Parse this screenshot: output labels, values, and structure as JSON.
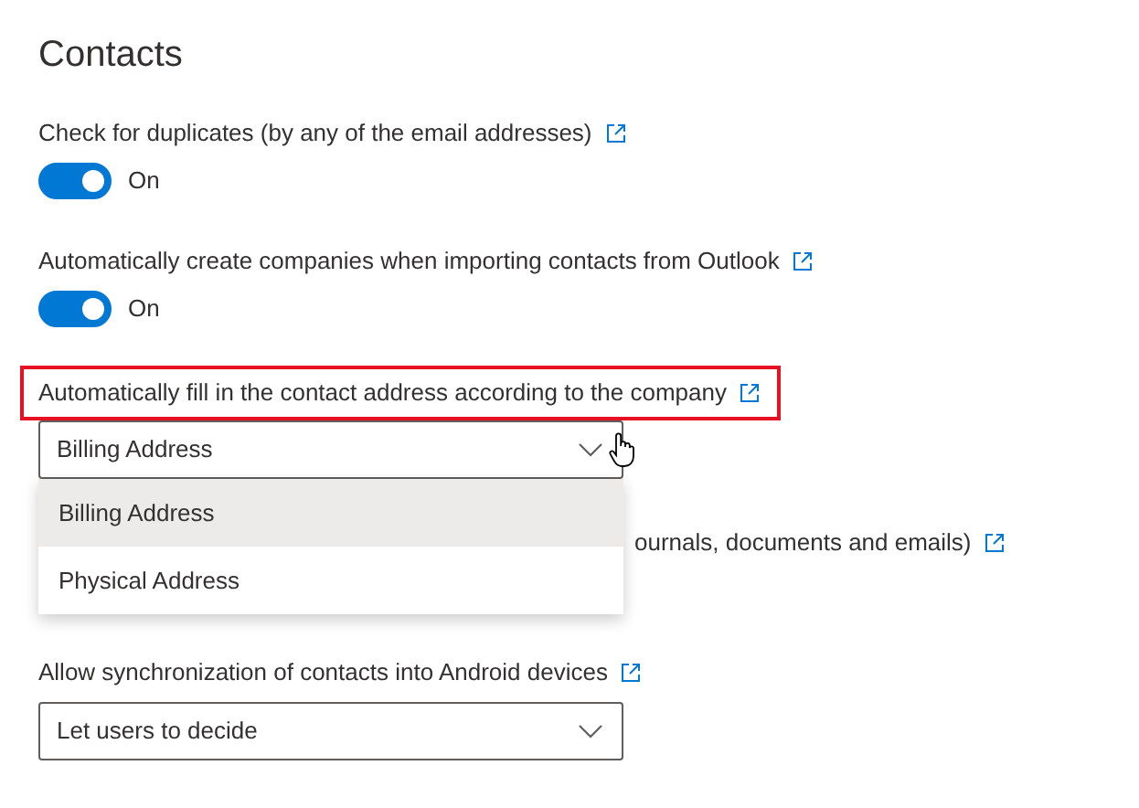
{
  "title": "Contacts",
  "settings": [
    {
      "kind": "toggle",
      "label": "Check for duplicates (by any of the email addresses)",
      "on": true,
      "state_text": "On"
    },
    {
      "kind": "toggle",
      "label": "Automatically create companies when importing contacts from Outlook",
      "on": true,
      "state_text": "On"
    },
    {
      "kind": "dropdown",
      "label": "Automatically fill in the contact address according to the company",
      "highlighted": true,
      "value": "Billing Address",
      "expanded": true,
      "options": [
        {
          "label": "Billing Address",
          "selected": true
        },
        {
          "label": "Physical Address",
          "selected": false
        }
      ]
    },
    {
      "kind": "covered",
      "label": "ournals, documents and emails)"
    },
    {
      "kind": "dropdown",
      "label": "Allow synchronization of contacts into Android devices",
      "highlighted": false,
      "value": "Let users to decide",
      "expanded": false
    }
  ]
}
